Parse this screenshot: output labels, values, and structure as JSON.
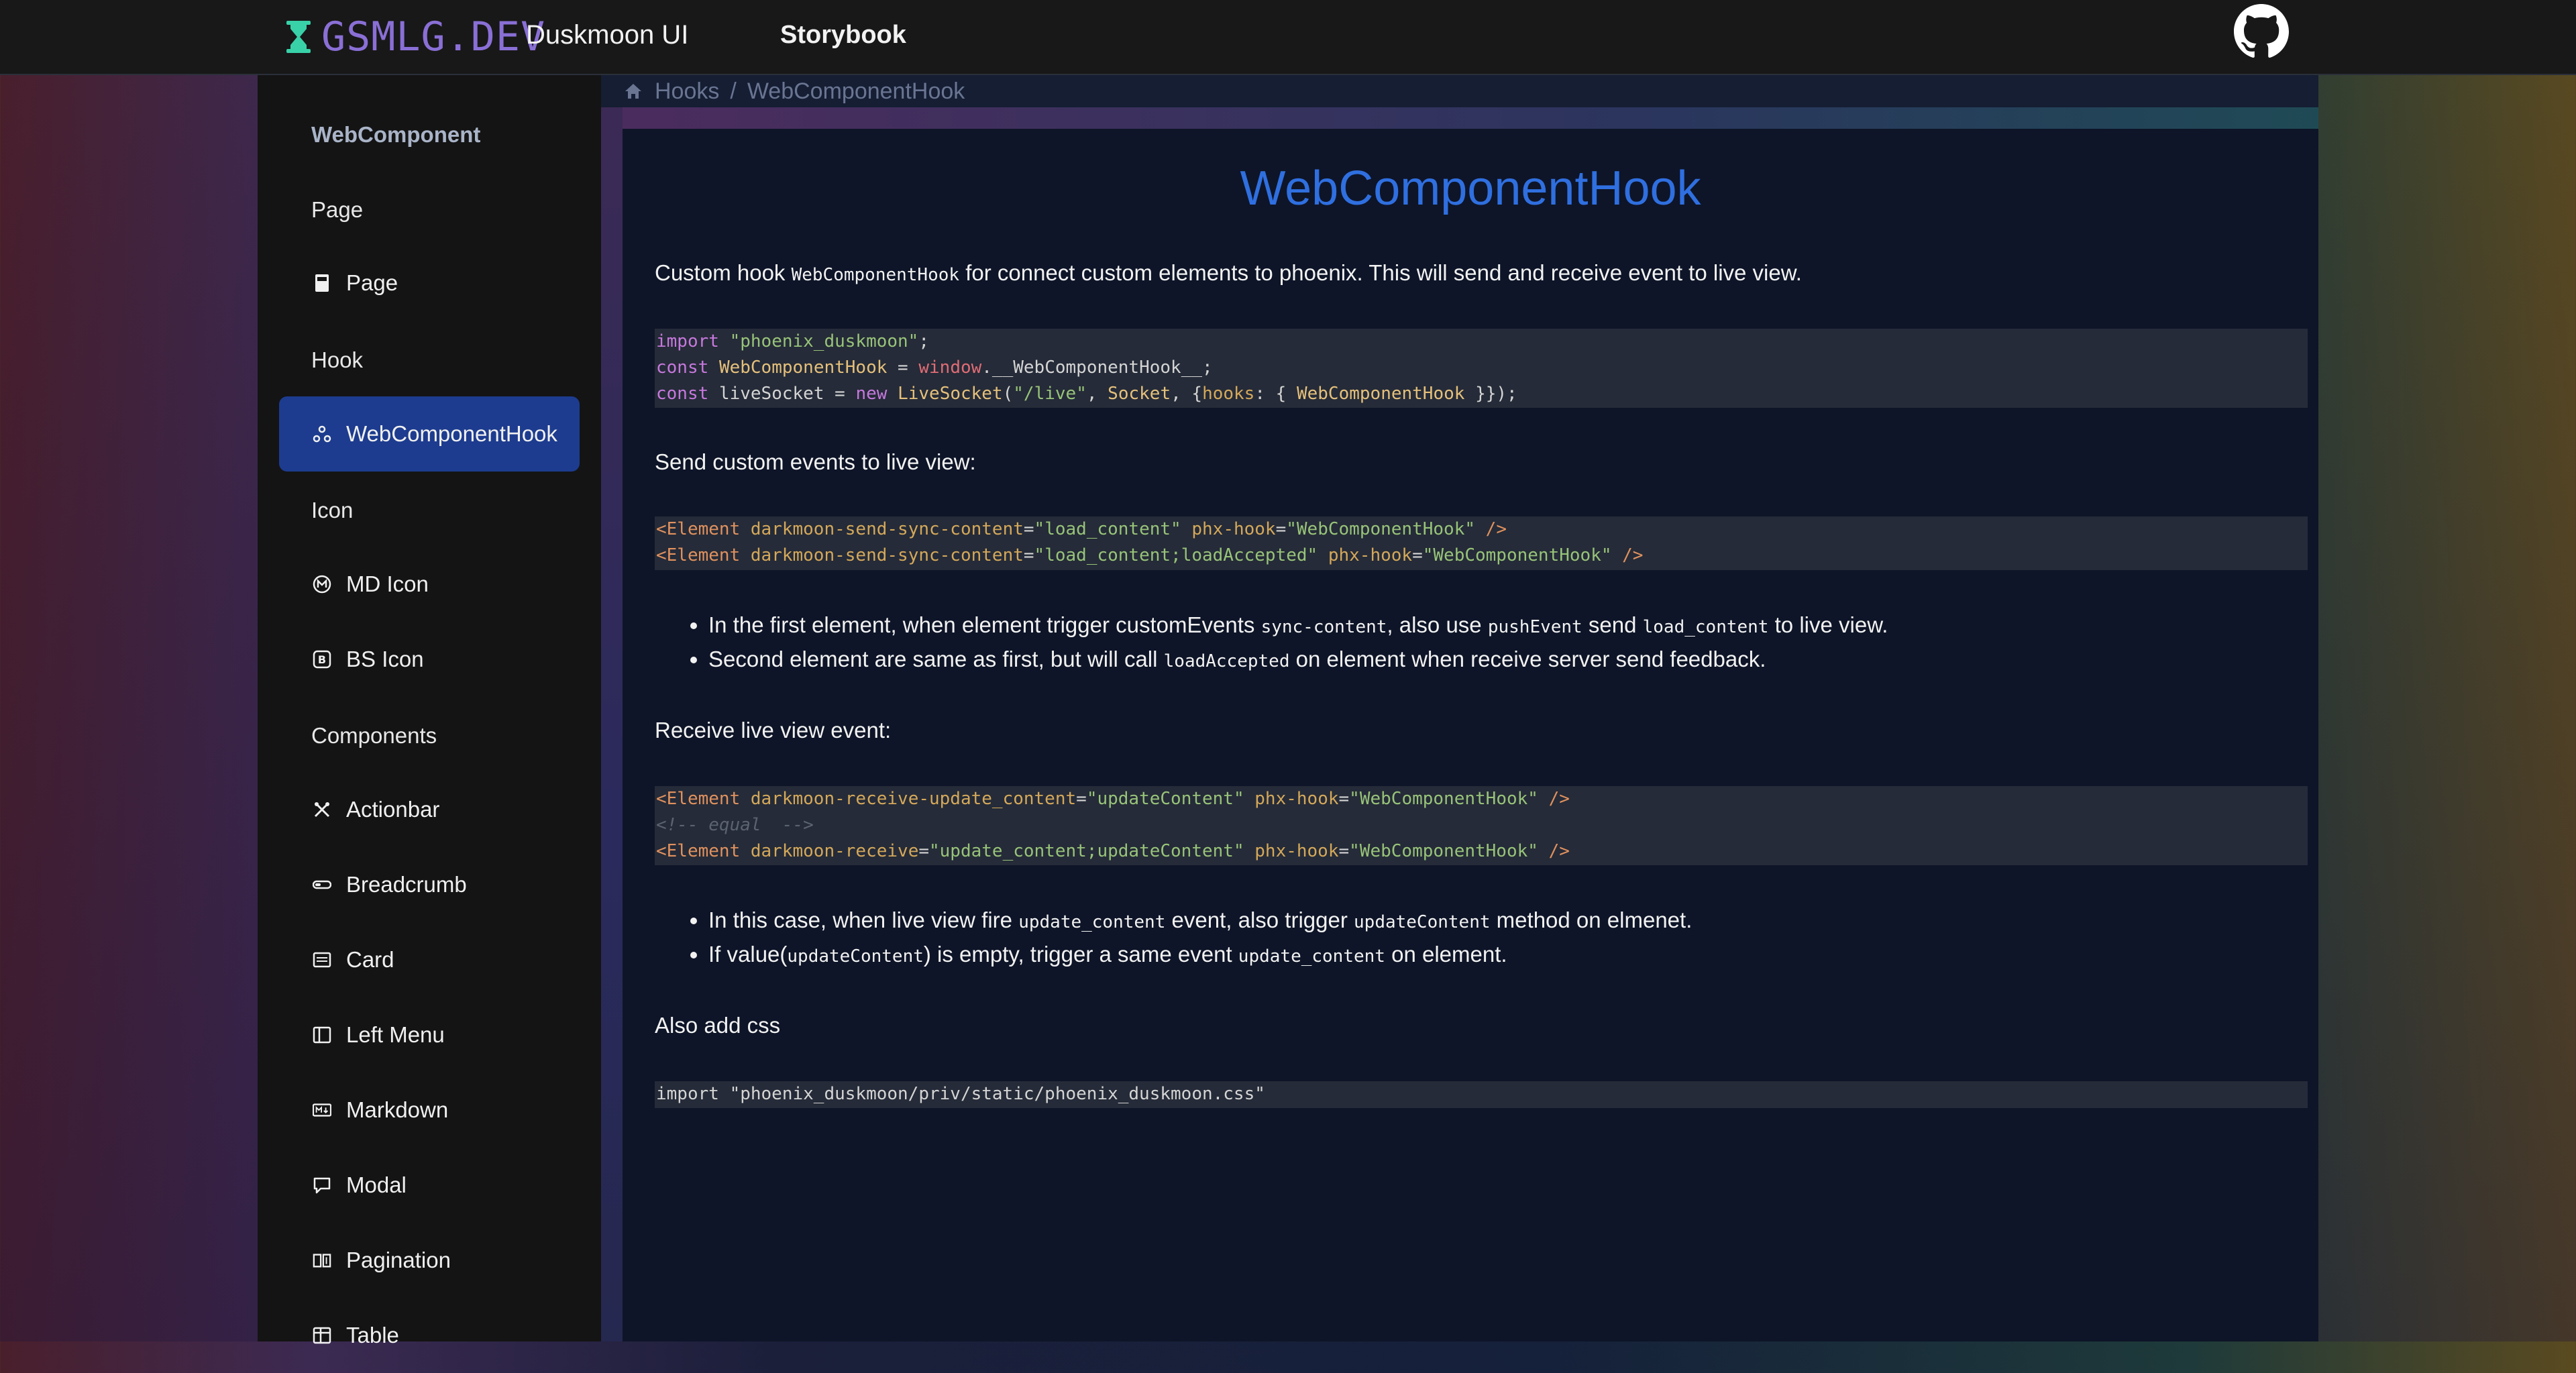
{
  "header": {
    "logo_text": "GSMLG.DEV",
    "brand": "Duskmoon UI",
    "nav_storybook": "Storybook"
  },
  "sidebar": {
    "sections": [
      {
        "title": "WebComponent"
      },
      {
        "title": "Page"
      },
      {
        "title": "Hook"
      },
      {
        "title": "Icon"
      },
      {
        "title": "Components"
      }
    ],
    "items": [
      {
        "label": "Page",
        "icon": "page-icon"
      },
      {
        "label": "WebComponentHook",
        "icon": "hook-icon",
        "active": true
      },
      {
        "label": "MD Icon",
        "icon": "md-icon"
      },
      {
        "label": "BS Icon",
        "icon": "bs-icon"
      },
      {
        "label": "Actionbar",
        "icon": "actionbar-icon"
      },
      {
        "label": "Breadcrumb",
        "icon": "breadcrumb-icon"
      },
      {
        "label": "Card",
        "icon": "card-icon"
      },
      {
        "label": "Left Menu",
        "icon": "left-menu-icon"
      },
      {
        "label": "Markdown",
        "icon": "markdown-icon"
      },
      {
        "label": "Modal",
        "icon": "modal-icon"
      },
      {
        "label": "Pagination",
        "icon": "pagination-icon"
      },
      {
        "label": "Table",
        "icon": "table-icon"
      }
    ],
    "active_color": "#1d3c8f"
  },
  "breadcrumb": {
    "items": [
      "Hooks",
      "WebComponentHook"
    ],
    "separator": "/"
  },
  "content": {
    "title": "WebComponentHook",
    "intro_before": "Custom hook ",
    "intro_code": "WebComponentHook",
    "intro_after": " for connect custom elements to phoenix. This will send and receive event to live view.",
    "code1": [
      "import \"phoenix_duskmoon\";",
      "const WebComponentHook = window.__WebComponentHook__;",
      "const liveSocket = new LiveSocket(\"/live\", Socket, {hooks: { WebComponentHook }});"
    ],
    "send_heading": "Send custom events to live view:",
    "code2": [
      "<Element darkmoon-send-sync-content=\"load_content\" phx-hook=\"WebComponentHook\" />",
      "<Element darkmoon-send-sync-content=\"load_content;loadAccepted\" phx-hook=\"WebComponentHook\" />"
    ],
    "send_bullets": [
      [
        "In the first element, when element trigger customEvents ",
        "sync-content",
        ", also use ",
        "pushEvent",
        " send ",
        "load_content",
        " to live view."
      ],
      [
        "Second element are same as first, but will call ",
        "loadAccepted",
        " on element when receive server send feedback."
      ]
    ],
    "receive_heading": "Receive live view event:",
    "code3": [
      "<Element darkmoon-receive-update_content=\"updateContent\" phx-hook=\"WebComponentHook\" />",
      "<!-- equal  -->",
      "<Element darkmoon-receive=\"update_content;updateContent\" phx-hook=\"WebComponentHook\" />"
    ],
    "receive_bullets": [
      [
        "In this case, when live view fire ",
        "update_content",
        " event, also trigger ",
        "updateContent",
        " method on elmenet."
      ],
      [
        "If value(",
        "updateContent",
        ") is empty, trigger a same event ",
        "update_content",
        " on element."
      ]
    ],
    "css_heading": "Also add css",
    "code4": "import \"phoenix_duskmoon/priv/static/phoenix_duskmoon.css\""
  },
  "colors": {
    "title": "#2f6fe0",
    "code_bg": "#252b38",
    "content_bg": "#0e1528"
  }
}
